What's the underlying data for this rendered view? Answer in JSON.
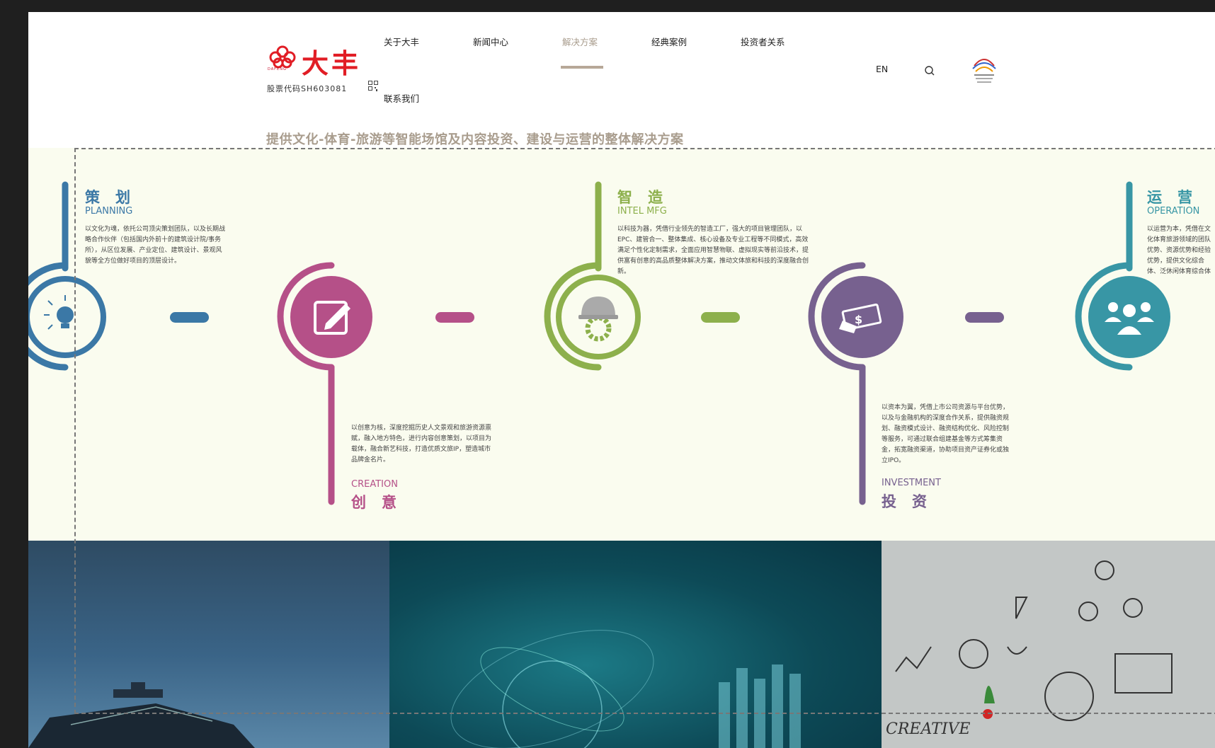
{
  "header": {
    "logo_text": "大丰",
    "logo_sub": "DAFENG",
    "stock_code": "股票代码SH603081",
    "nav": [
      {
        "label": "关于大丰",
        "active": false
      },
      {
        "label": "新闻中心",
        "active": false
      },
      {
        "label": "解决方案",
        "active": true
      },
      {
        "label": "经典案例",
        "active": false
      },
      {
        "label": "投资者关系",
        "active": false
      }
    ],
    "contact_label": "联系我们",
    "lang_label": "EN",
    "icons": {
      "search": "search-icon",
      "qr": "qr-code-icon",
      "badge": "event-badge-icon"
    }
  },
  "tagline": "提供文化-体育-旅游等智能场馆及内容投资、建设与运营的整体解决方案",
  "stages": [
    {
      "key": "planning",
      "title": "策划",
      "en": "PLANNING",
      "color": "#3b78a6",
      "icon": "lightbulb-icon",
      "desc": "以文化为魂，依托公司顶尖策划团队，以及长期战略合作伙伴（包括国内外前十的建筑设计院/事务所），从区位发展、产业定位、建筑设计、景观风貌等全方位做好项目的顶层设计。"
    },
    {
      "key": "creation",
      "title": "创意",
      "en": "CREATION",
      "color": "#b55088",
      "icon": "edit-icon",
      "desc": "以创意为核，深度挖掘历史人文景观和旅游资源禀赋，融入地方特色，进行内容创意策划，以项目为载体，融合新艺科技，打造优质文旅IP，塑造城市品牌金名片。"
    },
    {
      "key": "intel_mfg",
      "title": "智造",
      "en": "INTEL MFG",
      "color": "#8db04c",
      "icon": "helmet-gear-icon",
      "desc": "以科技为器，凭借行业领先的智造工厂，强大的项目管理团队，以EPC、建管合一、整体集成、核心设备及专业工程等不同模式，高效满足个性化定制需求，全面应用智慧物联、虚拟现实等前沿技术，提供富有创意的高品质整体解决方案，推动文体旅和科技的深度融合创新。"
    },
    {
      "key": "investment",
      "title": "投资",
      "en": "INVESTMENT",
      "color": "#77618f",
      "icon": "money-hand-icon",
      "desc": "以资本为翼，凭借上市公司资源与平台优势，以及与金融机构的深度合作关系，提供融资规划、融资模式设计、融资结构优化、风险控制等服务，可通过联合组建基金等方式筹集资金，拓宽融资渠道，协助项目资产证券化或独立IPO。"
    },
    {
      "key": "operation",
      "title": "运营",
      "en": "OPERATION",
      "color": "#3896a5",
      "icon": "team-icon",
      "desc": "以运营为本，凭借在文化体育旅游领域的团队优势、资源优势和经验优势，提供文化综合体、泛休闲体育综合体等项目的运营咨询、体系辅导、全托管等全方位服务。"
    }
  ],
  "photos": {
    "creative_text": "CREATIVE"
  }
}
